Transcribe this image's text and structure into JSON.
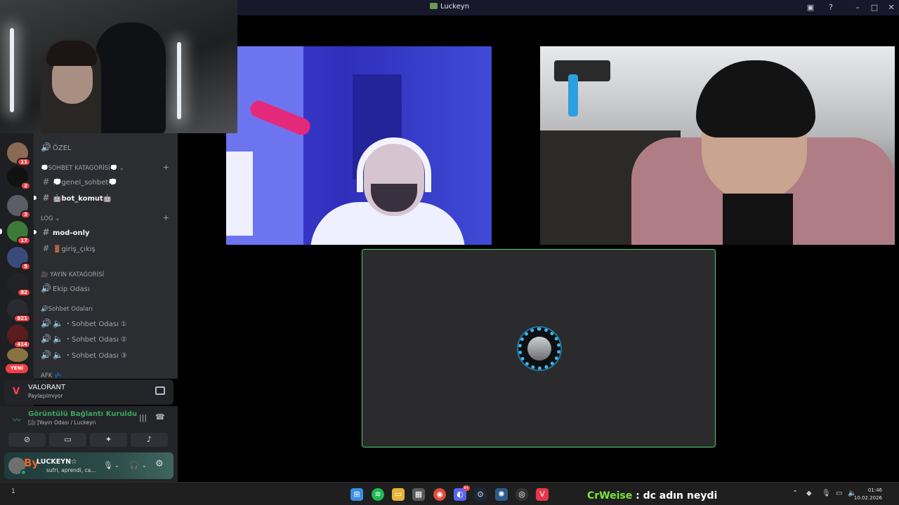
{
  "window": {
    "title": "Luckeyn"
  },
  "servers": [
    {
      "badge": "11"
    },
    {
      "badge": "2"
    },
    {
      "badge": "3"
    },
    {
      "badge": "17"
    },
    {
      "badge": "5"
    },
    {
      "badge": "82"
    },
    {
      "badge": "821"
    },
    {
      "badge": "414"
    },
    {
      "badge": ""
    }
  ],
  "servers_new_label": "YENİ",
  "channels": {
    "ozel": "ÖZEL",
    "cat_sohbet": "💭SOHBET KATAGORİSİ💭",
    "genel_sohbet": "💭genel_sohbet💭",
    "bot_komut": "🤖bot_komut🤖",
    "cat_log": "LOG",
    "mod_only": "mod-only",
    "giris_cikis": "🚪giriş_çıkış",
    "cat_yayin": "🎥 YAYIN KATAGORİSİ",
    "ekip_odasi": "Ekip Odası",
    "cat_sohbet_odalari": "🔊Sohbet Odaları",
    "sohbet_1": "・Sohbet Odası ①",
    "sohbet_2": "・Sohbet Odası ②",
    "sohbet_3": "・Sohbet Odası ③",
    "cat_afk": "AFK 💤"
  },
  "activity": {
    "game": "VALORANT",
    "status": "Paylaşılmıyor"
  },
  "voice": {
    "status": "Görüntülü Bağlantı Kuruldu",
    "location": "[🎥]Yayın Odası / Luckeyn"
  },
  "user": {
    "name": "LUCKEYN☆",
    "status": "sufri, aprendi, ca...",
    "deco": "By"
  },
  "taskbar": {
    "page_num": "1",
    "chat_user": "CrWeise",
    "chat_message": " : dc adın neydi",
    "time": "01:46",
    "date": "10.02.2026",
    "discord_badge": "9+"
  },
  "colors": {
    "accent_green": "#3ba55c",
    "badge_red": "#f23f43",
    "speaking_border": "#4ed06a"
  },
  "icons": [
    "discord-icon",
    "screen-share-icon",
    "help-icon",
    "minimize-icon",
    "maximize-icon",
    "close-icon",
    "hash-icon",
    "speaker-icon",
    "signal-icon",
    "hangup-icon",
    "mic-icon",
    "headphones-icon",
    "gear-icon"
  ]
}
